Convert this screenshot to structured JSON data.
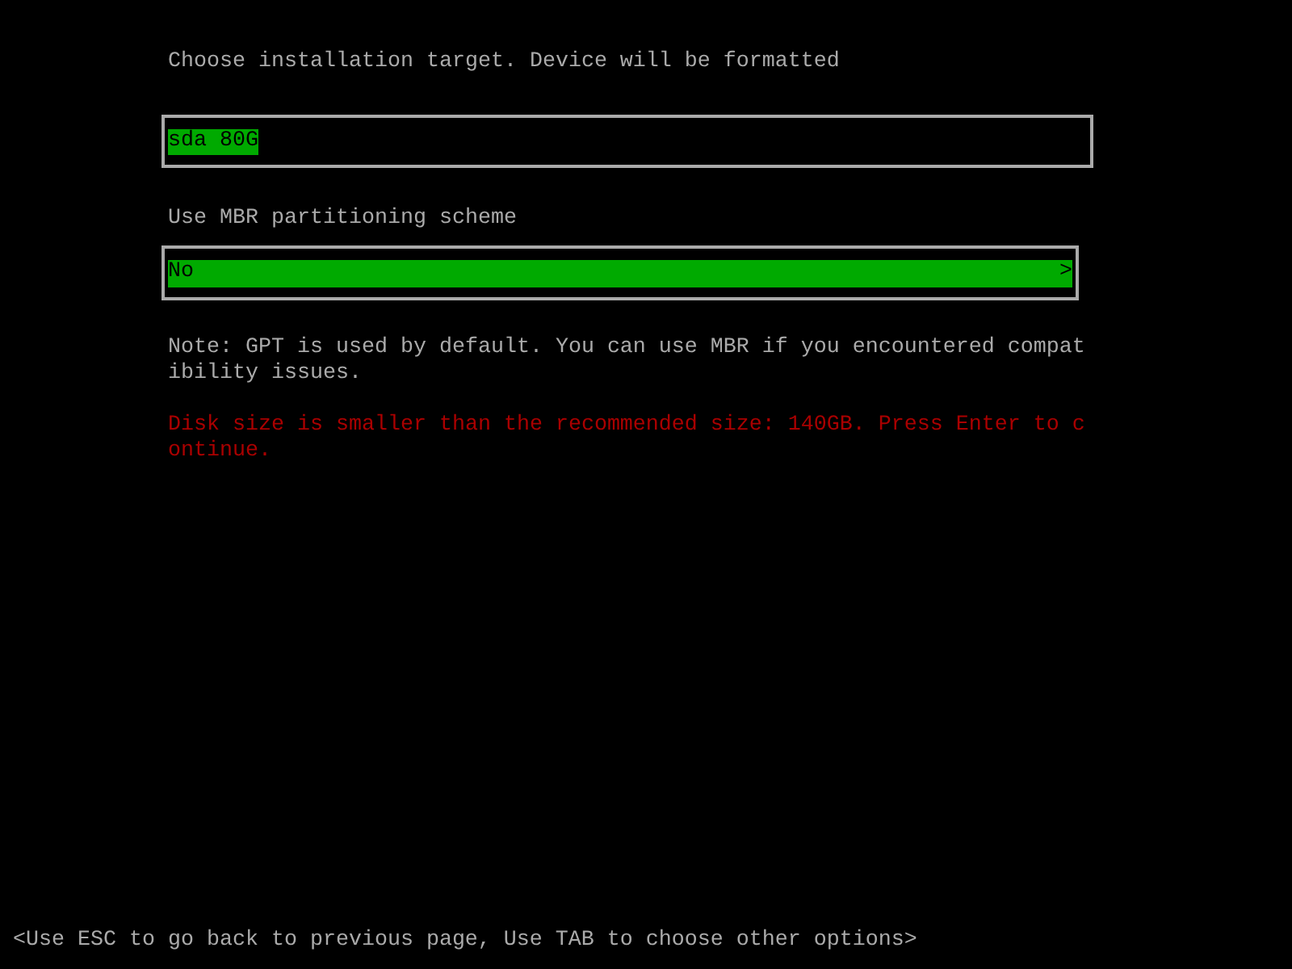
{
  "target": {
    "label": "Choose installation target. Device will be formatted",
    "value": "sda 80G",
    "selected": true
  },
  "mbr": {
    "label": "Use MBR partitioning scheme",
    "value": "No",
    "arrow": ">",
    "selected": true
  },
  "note": "Note: GPT is used by default. You can use MBR if you encountered compatibility issues.",
  "warning": "Disk size is smaller than the recommended size: 140GB. Press Enter to continue.",
  "footer": "<Use ESC to go back to previous page, Use TAB to choose other options>"
}
